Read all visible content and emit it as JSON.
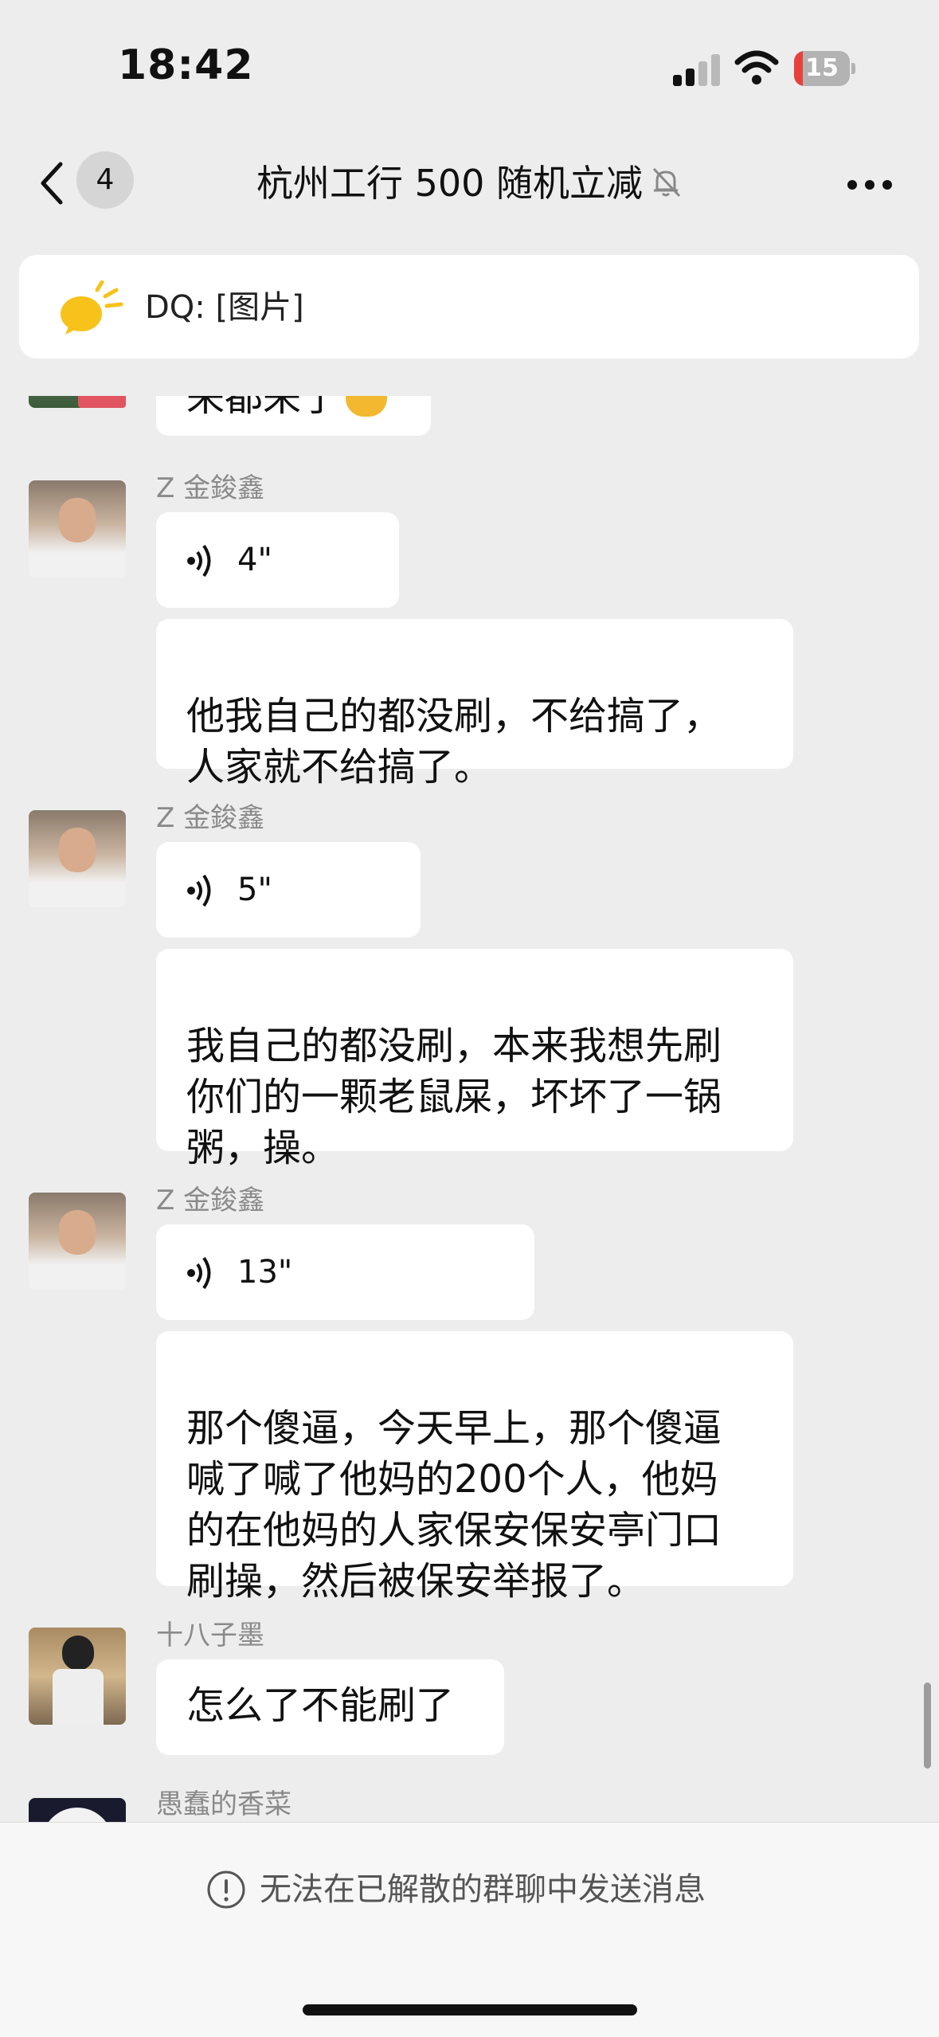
{
  "status_bar": {
    "time": "18:42",
    "battery": "15",
    "battery_level": 0.15
  },
  "nav": {
    "unread_count": "4",
    "title": "杭州工行 500 随机立减"
  },
  "pinned": {
    "text": "DQ: [图片]"
  },
  "messages": [
    {
      "sender": "Z 金鋑鑫",
      "voice_length": "4\"",
      "text": "他我自己的都没刷，不给搞了，\n人家就不给搞了。"
    },
    {
      "sender": "Z 金鋑鑫",
      "voice_length": "5\"",
      "text": "我自己的都没刷，本来我想先刷\n你们的一颗老鼠屎，坏坏了一锅\n粥，操。"
    },
    {
      "sender": "Z 金鋑鑫",
      "voice_length": "13\"",
      "text": "那个傻逼，今天早上，那个傻逼\n喊了喊了他妈的200个人，他妈\n的在他妈的人家保安保安亭门口\n刷操，然后被保安举报了。"
    },
    {
      "sender": "十八子墨",
      "text": "怎么了不能刷了"
    },
    {
      "sender": "愚蠢的香菜"
    }
  ],
  "top_cut_message": "来都来了",
  "footer": {
    "notice": "无法在已解散的群聊中发送消息"
  },
  "colors": {
    "background": "#ededed",
    "bubble": "#ffffff",
    "battery_low": "#e8413c"
  }
}
